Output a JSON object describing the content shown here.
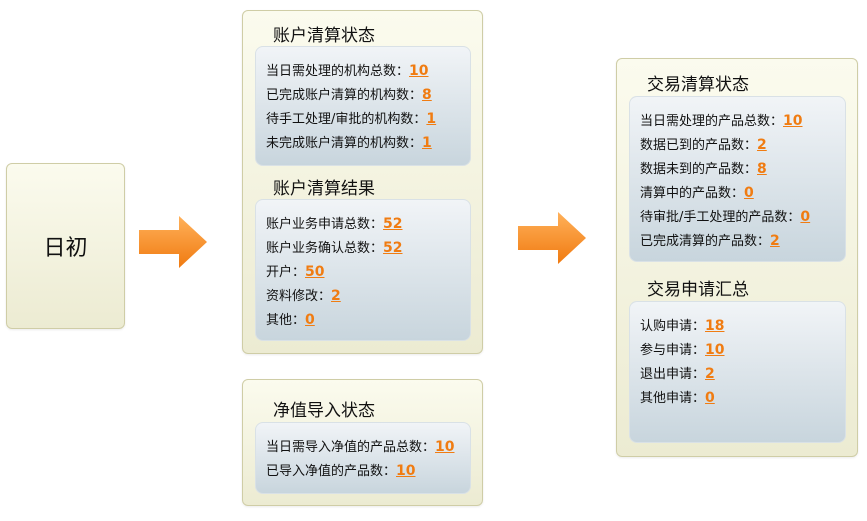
{
  "start": {
    "label": "日初"
  },
  "account_status": {
    "title": "账户清算状态",
    "rows": [
      {
        "label": "当日需处理的机构总数：",
        "value": "10"
      },
      {
        "label": "已完成账户清算的机构数：",
        "value": "8"
      },
      {
        "label": "待手工处理/审批的机构数：",
        "value": "1"
      },
      {
        "label": "未完成账户清算的机构数：",
        "value": "1"
      }
    ]
  },
  "account_result": {
    "title": "账户清算结果",
    "rows": [
      {
        "label": "账户业务申请总数：",
        "value": "52"
      },
      {
        "label": "账户业务确认总数：",
        "value": "52"
      },
      {
        "label": "开户：",
        "value": "50"
      },
      {
        "label": "资料修改：",
        "value": "2"
      },
      {
        "label": "其他：",
        "value": "0"
      }
    ]
  },
  "nav_import": {
    "title": "净值导入状态",
    "rows": [
      {
        "label": "当日需导入净值的产品总数：",
        "value": "10"
      },
      {
        "label": "已导入净值的产品数：",
        "value": "10"
      }
    ]
  },
  "trade_status": {
    "title": "交易清算状态",
    "rows": [
      {
        "label": "当日需处理的产品总数：",
        "value": "10"
      },
      {
        "label": "数据已到的产品数：",
        "value": "2"
      },
      {
        "label": "数据未到的产品数：",
        "value": "8"
      },
      {
        "label": "清算中的产品数：",
        "value": "0"
      },
      {
        "label": "待审批/手工处理的产品数：",
        "value": "0"
      },
      {
        "label": "已完成清算的产品数：",
        "value": "2"
      }
    ]
  },
  "trade_summary": {
    "title": "交易申请汇总",
    "rows": [
      {
        "label": "认购申请：",
        "value": "18"
      },
      {
        "label": "参与申请：",
        "value": "10"
      },
      {
        "label": "退出申请：",
        "value": "2"
      },
      {
        "label": "其他申请：",
        "value": "0"
      }
    ]
  },
  "colors": {
    "accent": "#f07c12",
    "arrow": "#f5901f",
    "panel": "#f4f3e0"
  }
}
